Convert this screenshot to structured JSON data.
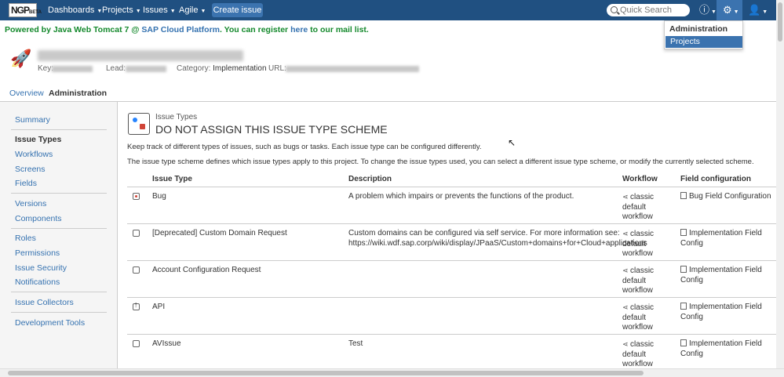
{
  "topbar": {
    "logo": "NGP",
    "logo_sub": "BETA",
    "nav": [
      {
        "label": "Dashboards"
      },
      {
        "label": "Projects"
      },
      {
        "label": "Issues"
      },
      {
        "label": "Agile"
      }
    ],
    "create_issue": "Create issue",
    "search_placeholder": "Quick Search",
    "help_icon": "help-icon",
    "gear_icon": "gear-icon",
    "user_icon": "user-icon"
  },
  "banner": {
    "text_1": "Powered by Java Web Tomcat 7 @ ",
    "link_1": "SAP Cloud Platform",
    "text_2": ". You can register ",
    "link_2": "here",
    "text_3": " to our mail list."
  },
  "admin_menu": {
    "heading": "Administration",
    "item": "Projects"
  },
  "project": {
    "name": "InnovativeIdeas_ReusableComponents",
    "key_label": "Key:",
    "lead_label": "Lead:",
    "category_label": "Category:",
    "category_value": "Implementation",
    "url_label": "URL:"
  },
  "tabs": [
    "Overview",
    "Administration"
  ],
  "sidebar": {
    "items": [
      "Summary",
      "Issue Types",
      "Workflows",
      "Screens",
      "Fields",
      "Versions",
      "Components",
      "Roles",
      "Permissions",
      "Issue Security",
      "Notifications",
      "Issue Collectors",
      "Development Tools"
    ]
  },
  "main": {
    "crumb": "Issue Types",
    "title": "DO NOT ASSIGN THIS ISSUE TYPE SCHEME",
    "desc1": "Keep track of different types of issues, such as bugs or tasks. Each issue type can be configured differently.",
    "desc2": "The issue type scheme defines which issue types apply to this project. To change the issue types used, you can select a different issue type scheme, or modify the currently selected scheme.",
    "columns": [
      "Issue Type",
      "Description",
      "Workflow",
      "Field configuration"
    ],
    "rows": [
      {
        "type": "Bug",
        "icon": "bug",
        "desc_1": "A problem which impairs or prevents the functions of the product.",
        "desc_2": "",
        "wf_1": "classic",
        "wf_2": "default",
        "wf_3": "workflow",
        "field": "Bug Field Configuration"
      },
      {
        "type": "[Deprecated] Custom Domain Request",
        "icon": "task",
        "desc_1": "Custom domains can be configured via self service. For more information see:",
        "desc_2": "https://wiki.wdf.sap.corp/wiki/display/JPaaS/Custom+domains+for+Cloud+applications",
        "wf_1": "classic",
        "wf_2": "default",
        "wf_3": "workflow",
        "field": "Implementation Field Config"
      },
      {
        "type": "Account Configuration Request",
        "icon": "task",
        "desc_1": "",
        "desc_2": "",
        "wf_1": "classic",
        "wf_2": "default",
        "wf_3": "workflow",
        "field": "Implementation Field Config"
      },
      {
        "type": "API",
        "icon": "api",
        "desc_1": "",
        "desc_2": "",
        "wf_1": "classic",
        "wf_2": "default",
        "wf_3": "workflow",
        "field": "Implementation Field Config"
      },
      {
        "type": "AVIssue",
        "icon": "task",
        "desc_1": "Test",
        "desc_2": "",
        "wf_1": "classic",
        "wf_2": "default",
        "wf_3": "workflow",
        "field": "Implementation Field Config"
      }
    ]
  },
  "colors": {
    "header": "#205081",
    "accent": "#3b73af",
    "link": "#3572b0",
    "banner_green": "#14892c"
  }
}
